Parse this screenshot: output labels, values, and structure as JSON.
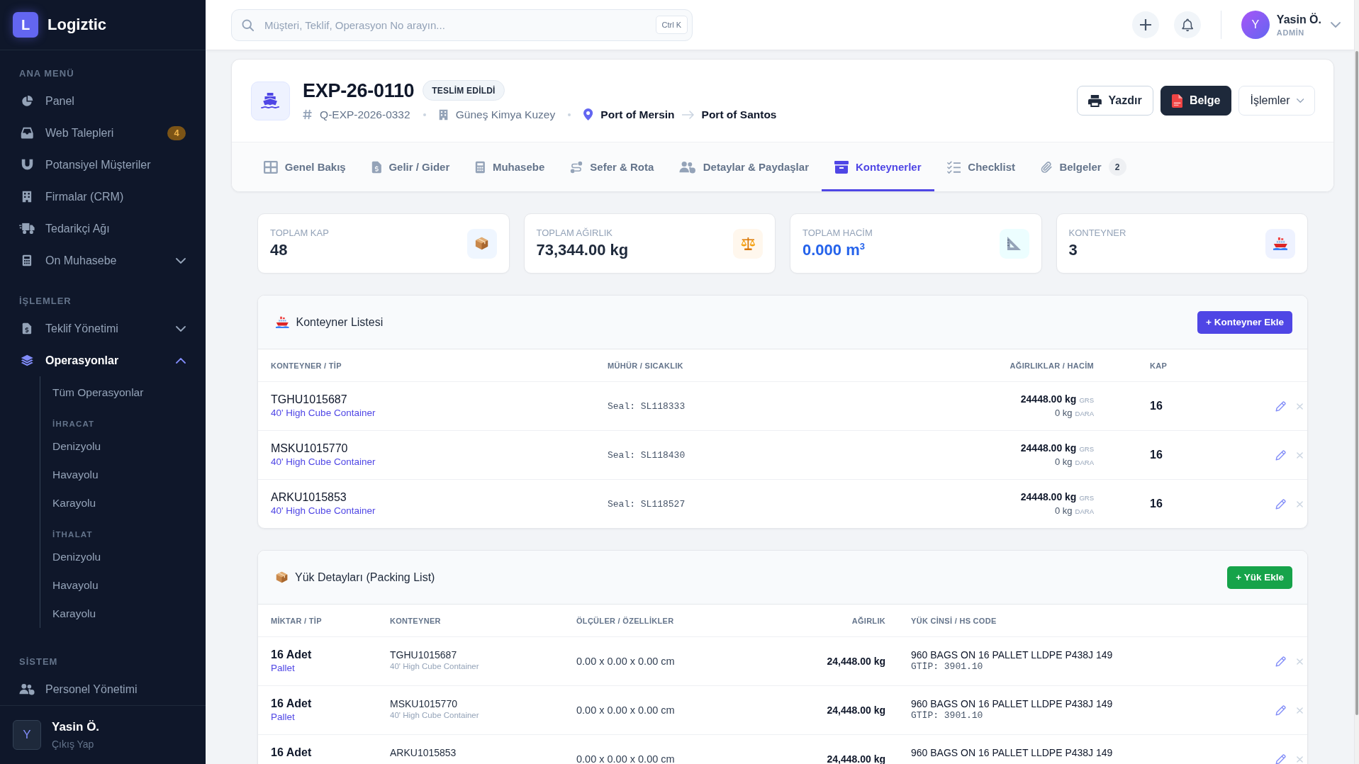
{
  "sidebar": {
    "logo": {
      "letter": "L",
      "name": "Logiztic"
    },
    "sections": [
      {
        "title": "ANA MENÜ",
        "items": [
          {
            "label": "Panel",
            "selected": false
          },
          {
            "label": "Web Talepleri",
            "selected": false,
            "badge": "4"
          },
          {
            "label": "Potansiyel Müşteriler",
            "selected": false
          },
          {
            "label": "Firmalar (CRM)",
            "selected": false
          },
          {
            "label": "Tedarikçi Ağı",
            "selected": false
          },
          {
            "label": "On Muhasebe",
            "selected": false,
            "expanded": false
          }
        ]
      },
      {
        "title": "İŞLEMLER",
        "items": [
          {
            "label": "Teklif Yönetimi",
            "selected": false,
            "expanded": false
          },
          {
            "label": "Operasyonlar",
            "selected": true,
            "expanded": true,
            "children": [
              {
                "kind": "link",
                "label": "Tüm Operasyonlar",
                "selected": false
              },
              {
                "kind": "heading",
                "label": "İHRACAT"
              },
              {
                "kind": "link",
                "label": "Denizyolu",
                "selected": false
              },
              {
                "kind": "link",
                "label": "Havayolu",
                "selected": false
              },
              {
                "kind": "link",
                "label": "Karayolu",
                "selected": false
              },
              {
                "kind": "heading",
                "label": "İTHALAT"
              },
              {
                "kind": "link",
                "label": "Denizyolu",
                "selected": false
              },
              {
                "kind": "link",
                "label": "Havayolu",
                "selected": false
              },
              {
                "kind": "link",
                "label": "Karayolu",
                "selected": false
              }
            ]
          }
        ]
      },
      {
        "title": "SİSTEM",
        "items": [
          {
            "label": "Personel Yönetimi",
            "selected": false
          }
        ]
      }
    ],
    "user": {
      "initial": "Y",
      "name": "Yasin Ö.",
      "action": "Çıkış Yap"
    }
  },
  "topbar": {
    "search": {
      "placeholder": "Müşteri, Teklif, Operasyon No arayın...",
      "shortcut": "Ctrl K"
    },
    "user": {
      "initial": "Y",
      "name": "Yasin Ö.",
      "role": "ADMİN"
    }
  },
  "operation": {
    "code": "EXP-26-0110",
    "status": "TESLİM EDİLDİ",
    "reference": "Q-EXP-2026-0332",
    "company": "Güneş Kimya Kuzey",
    "origin": "Port of Mersin",
    "destination": "Port of Santos",
    "actions": [
      {
        "kind": "outline",
        "label": "Yazdır"
      },
      {
        "kind": "dark",
        "label": "Belge"
      },
      {
        "kind": "menu",
        "label": "İşlemler"
      }
    ]
  },
  "tabs": [
    {
      "label": "Genel Bakış",
      "selected": false
    },
    {
      "label": "Gelir / Gider",
      "selected": false
    },
    {
      "label": "Muhasebe",
      "selected": false
    },
    {
      "label": "Sefer & Rota",
      "selected": false
    },
    {
      "label": "Detaylar & Paydaşlar",
      "selected": false
    },
    {
      "label": "Konteynerler",
      "selected": true
    },
    {
      "label": "Checklist",
      "selected": false
    },
    {
      "label": "Belgeler",
      "selected": false,
      "count": "2"
    }
  ],
  "stats": [
    {
      "label": "TOPLAM KAP",
      "value": "48",
      "color": "#1e293b"
    },
    {
      "label": "TOPLAM AĞIRLIK",
      "value": "73,344.00 kg",
      "color": "#1e293b"
    },
    {
      "label": "TOPLAM HACİM",
      "value": "0.000 m$^{3}$",
      "color": "#2563eb"
    },
    {
      "label": "KONTEYNER",
      "value": "3",
      "color": "#1e293b"
    }
  ],
  "containers": {
    "title": "Konteyner Listesi",
    "add_button": "+ Konteyner Ekle",
    "columns": [
      "KONTEYNER / TİP",
      "MÜHÜR / SICAKLIK",
      "AĞIRLIKLAR / HACİM",
      "KAP"
    ],
    "rows": [
      {
        "number": "TGHU1015687",
        "type": "40' High Cube Container",
        "seal": "Seal: SL118333",
        "gross_weight": "24448.00 kg",
        "gross_label": "GRS",
        "tare_weight": "0 kg",
        "tare_label": "DARA",
        "packages": "16"
      },
      {
        "number": "MSKU1015770",
        "type": "40' High Cube Container",
        "seal": "Seal: SL118430",
        "gross_weight": "24448.00 kg",
        "gross_label": "GRS",
        "tare_weight": "0 kg",
        "tare_label": "DARA",
        "packages": "16"
      },
      {
        "number": "ARKU1015853",
        "type": "40' High Cube Container",
        "seal": "Seal: SL118527",
        "gross_weight": "24448.00 kg",
        "gross_label": "GRS",
        "tare_weight": "0 kg",
        "tare_label": "DARA",
        "packages": "16"
      }
    ]
  },
  "packing_list": {
    "title": "Yük Detayları (Packing List)",
    "add_button": "+ Yük Ekle",
    "columns": [
      "MİKTAR / TİP",
      "KONTEYNER",
      "ÖLÇÜLER / ÖZELLİKLER",
      "AĞIRLIK",
      "YÜK CİNSİ / HS CODE"
    ],
    "rows": [
      {
        "quantity": "16 Adet",
        "package_type": "Pallet",
        "container": "TGHU1015687",
        "container_type": "40' High Cube Container",
        "dimensions": "0.00 x 0.00 x 0.00 cm",
        "weight": "24,448.00 kg",
        "description": "960 BAGS ON 16 PALLET LLDPE P438J 149",
        "hs_code": "GTİP: 3901.10"
      },
      {
        "quantity": "16 Adet",
        "package_type": "Pallet",
        "container": "MSKU1015770",
        "container_type": "40' High Cube Container",
        "dimensions": "0.00 x 0.00 x 0.00 cm",
        "weight": "24,448.00 kg",
        "description": "960 BAGS ON 16 PALLET LLDPE P438J 149",
        "hs_code": "GTİP: 3901.10"
      },
      {
        "quantity": "16 Adet",
        "container": "ARKU1015853",
        "dimensions": "0.00 x 0.00 x 0.00 cm",
        "weight": "24,448.00 kg",
        "description": "960 BAGS ON 16 PALLET LLDPE P438J 149"
      }
    ]
  }
}
